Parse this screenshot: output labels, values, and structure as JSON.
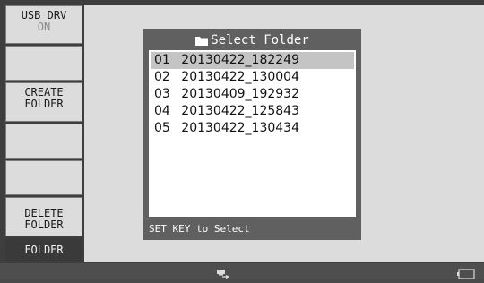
{
  "sidebar": {
    "items": [
      {
        "label": "USB DRV",
        "sub": "ON"
      },
      {
        "label": ""
      },
      {
        "label": "CREATE\nFOLDER"
      },
      {
        "label": ""
      },
      {
        "label": ""
      },
      {
        "label": "DELETE\nFOLDER"
      },
      {
        "label": "FOLDER"
      }
    ],
    "usb_drv_label": "USB DRV",
    "usb_drv_value": "ON",
    "create_line1": "CREATE",
    "create_line2": "FOLDER",
    "delete_line1": "DELETE",
    "delete_line2": "FOLDER",
    "folder_label": "FOLDER"
  },
  "dialog": {
    "title": "Select Folder",
    "title_icon": "folder-icon",
    "hint": "SET KEY to Select",
    "folders": [
      {
        "num": "01",
        "name": "20130422_182249"
      },
      {
        "num": "02",
        "name": "20130422_130004"
      },
      {
        "num": "03",
        "name": "20130409_192932"
      },
      {
        "num": "04",
        "name": "20130422_125843"
      },
      {
        "num": "05",
        "name": "20130422_130434"
      }
    ],
    "selected_index": 0
  },
  "statusbar": {
    "icons": [
      "usb-connection-icon",
      "battery-icon"
    ]
  },
  "colors": {
    "background": "#3e3e3e",
    "panel": "#dcdcdc",
    "dialog": "#606060",
    "selection": "#c4c4c4",
    "active_key": "#3a3a3a"
  }
}
